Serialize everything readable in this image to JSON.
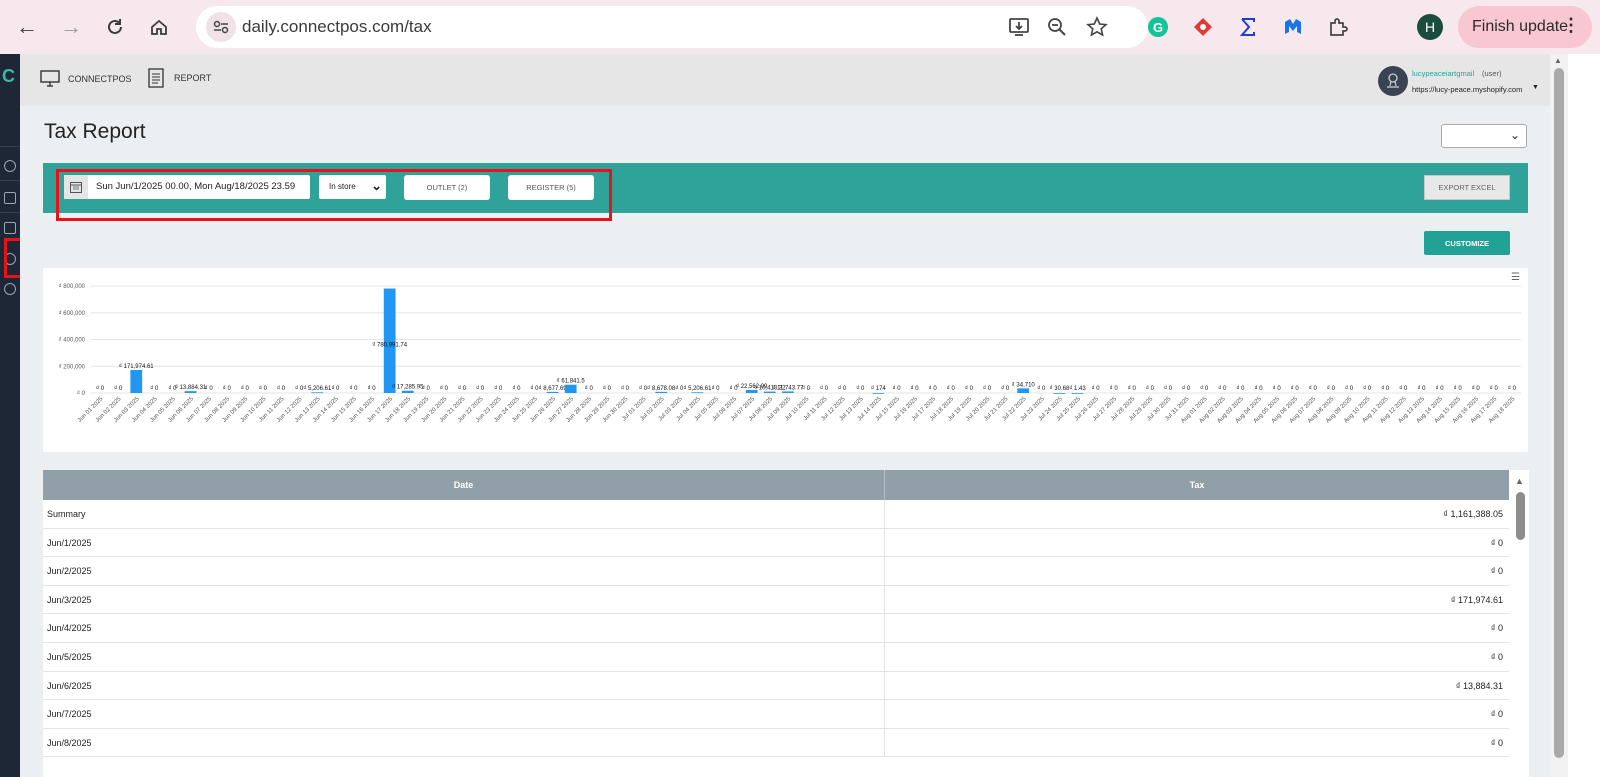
{
  "browser": {
    "url": "daily.connectpos.com/tax",
    "profile_initial": "H",
    "finish_update_label": "Finish update"
  },
  "sidebar": {
    "logo": "C"
  },
  "header": {
    "nav": [
      {
        "label": "CONNECTPOS",
        "icon": "monitor-icon"
      },
      {
        "label": "REPORT",
        "icon": "report-icon"
      }
    ],
    "user": {
      "email": "lucypeaceiartgmail",
      "role": "(user)",
      "store_url": "https://lucy-peace.myshopify.com"
    }
  },
  "page": {
    "title": "Tax Report"
  },
  "filters": {
    "date_range": "Sun Jun/1/2025 00.00, Mon Aug/18/2025 23.59",
    "store_type": "In store",
    "outlet_label": "OUTLET (2)",
    "register_label": "REGISTER (5)",
    "export_label": "EXPORT EXCEL",
    "customize_label": "CUSTOMIZE"
  },
  "chart_data": {
    "type": "bar",
    "currency_symbol": "₫",
    "ylim": [
      0,
      800000
    ],
    "y_ticks": [
      "₫ 0",
      "₫ 200,000",
      "₫ 400,000",
      "₫ 600,000",
      "₫ 800,000"
    ],
    "y_tick_values": [
      0,
      200000,
      400000,
      600000,
      800000
    ],
    "bar_color": "#2196f3",
    "categories": [
      "Jun 01 2025",
      "Jun 02 2025",
      "Jun 03 2025",
      "Jun 04 2025",
      "Jun 05 2025",
      "Jun 06 2025",
      "Jun 07 2025",
      "Jun 08 2025",
      "Jun 09 2025",
      "Jun 10 2025",
      "Jun 11 2025",
      "Jun 12 2025",
      "Jun 13 2025",
      "Jun 14 2025",
      "Jun 15 2025",
      "Jun 16 2025",
      "Jun 17 2025",
      "Jun 18 2025",
      "Jun 19 2025",
      "Jun 20 2025",
      "Jun 21 2025",
      "Jun 22 2025",
      "Jun 23 2025",
      "Jun 24 2025",
      "Jun 25 2025",
      "Jun 26 2025",
      "Jun 27 2025",
      "Jun 28 2025",
      "Jun 29 2025",
      "Jun 30 2025",
      "Jul 01 2025",
      "Jul 02 2025",
      "Jul 03 2025",
      "Jul 04 2025",
      "Jul 05 2025",
      "Jul 06 2025",
      "Jul 07 2025",
      "Jul 08 2025",
      "Jul 09 2025",
      "Jul 10 2025",
      "Jul 11 2025",
      "Jul 12 2025",
      "Jul 13 2025",
      "Jul 14 2025",
      "Jul 15 2025",
      "Jul 16 2025",
      "Jul 17 2025",
      "Jul 18 2025",
      "Jul 19 2025",
      "Jul 20 2025",
      "Jul 21 2025",
      "Jul 22 2025",
      "Jul 23 2025",
      "Jul 24 2025",
      "Jul 25 2025",
      "Jul 26 2025",
      "Jul 27 2025",
      "Jul 28 2025",
      "Jul 29 2025",
      "Jul 30 2025",
      "Jul 31 2025",
      "Aug 01 2025",
      "Aug 02 2025",
      "Aug 03 2025",
      "Aug 04 2025",
      "Aug 05 2025",
      "Aug 06 2025",
      "Aug 07 2025",
      "Aug 08 2025",
      "Aug 09 2025",
      "Aug 10 2025",
      "Aug 11 2025",
      "Aug 12 2025",
      "Aug 13 2025",
      "Aug 14 2025",
      "Aug 15 2025",
      "Aug 16 2025",
      "Aug 17 2025",
      "Aug 18 2025"
    ],
    "values": [
      0,
      0,
      171974.61,
      0,
      0,
      13884.31,
      0,
      0,
      0,
      0,
      0,
      0,
      5206.61,
      0,
      0,
      0,
      780991.74,
      17285.95,
      0,
      0,
      0,
      0,
      0,
      0,
      0,
      8677.69,
      61841.5,
      0,
      0,
      0,
      0,
      8678.08,
      0,
      5206.61,
      0,
      0,
      22562.09,
      10413.22,
      11743.77,
      0,
      0,
      0,
      0,
      174,
      0,
      0,
      0,
      0,
      0,
      0,
      0,
      34710,
      0,
      30.68,
      1.43,
      0,
      0,
      0,
      0,
      0,
      0,
      0,
      0,
      0,
      0,
      0,
      0,
      0,
      0,
      0,
      0,
      0,
      0,
      0,
      0,
      0,
      0,
      0,
      0
    ],
    "data_labels": [
      "₫ 0",
      "₫ 0",
      "₫ 171,974.61",
      "₫ 0",
      "₫ 0",
      "₫ 13,884.31",
      "₫ 0",
      "₫ 0",
      "₫ 0",
      "₫ 0",
      "₫ 0",
      "₫ 0",
      "₫ 5,206.61",
      "₫ 0",
      "₫ 0",
      "₫ 0",
      "₫ 780,991.74",
      "₫ 17,285.95",
      "₫ 0",
      "₫ 0",
      "₫ 0",
      "₫ 0",
      "₫ 0",
      "₫ 0",
      "₫ 0",
      "₫ 8,677.69",
      "₫ 61,841.5",
      "₫ 0",
      "₫ 0",
      "₫ 0",
      "₫ 0",
      "₫ 8,678.08",
      "₫ 0",
      "₫ 5,206.61",
      "₫ 0",
      "₫ 0",
      "₫ 22,562.09",
      "₫ 10,413.22",
      "₫ 11,743.77",
      "₫ 0",
      "₫ 0",
      "₫ 0",
      "₫ 0",
      "₫ 174",
      "₫ 0",
      "₫ 0",
      "₫ 0",
      "₫ 0",
      "₫ 0",
      "₫ 0",
      "₫ 0",
      "₫ 34,710",
      "₫ 0",
      "₫ 30.68",
      "₫ 1.43",
      "₫ 0",
      "₫ 0",
      "₫ 0",
      "₫ 0",
      "₫ 0",
      "₫ 0",
      "₫ 0",
      "₫ 0",
      "₫ 0",
      "₫ 0",
      "₫ 0",
      "₫ 0",
      "₫ 0",
      "₫ 0",
      "₫ 0",
      "₫ 0",
      "₫ 0",
      "₫ 0",
      "₫ 0",
      "₫ 0",
      "₫ 0",
      "₫ 0",
      "₫ 0",
      "₫ 0"
    ],
    "grid": true,
    "legend": "none"
  },
  "table": {
    "columns": [
      "Date",
      "Tax"
    ],
    "rows": [
      {
        "date": "Summary",
        "tax": "₫ 1,161,388.05"
      },
      {
        "date": "Jun/1/2025",
        "tax": "₫ 0"
      },
      {
        "date": "Jun/2/2025",
        "tax": "₫ 0"
      },
      {
        "date": "Jun/3/2025",
        "tax": "₫ 171,974.61"
      },
      {
        "date": "Jun/4/2025",
        "tax": "₫ 0"
      },
      {
        "date": "Jun/5/2025",
        "tax": "₫ 0"
      },
      {
        "date": "Jun/6/2025",
        "tax": "₫ 13,884.31"
      },
      {
        "date": "Jun/7/2025",
        "tax": "₫ 0"
      },
      {
        "date": "Jun/8/2025",
        "tax": "₫ 0"
      }
    ]
  },
  "colors": {
    "teal": "#2fa39a",
    "highlight_red": "#e8121a",
    "table_header": "#919fa8"
  }
}
